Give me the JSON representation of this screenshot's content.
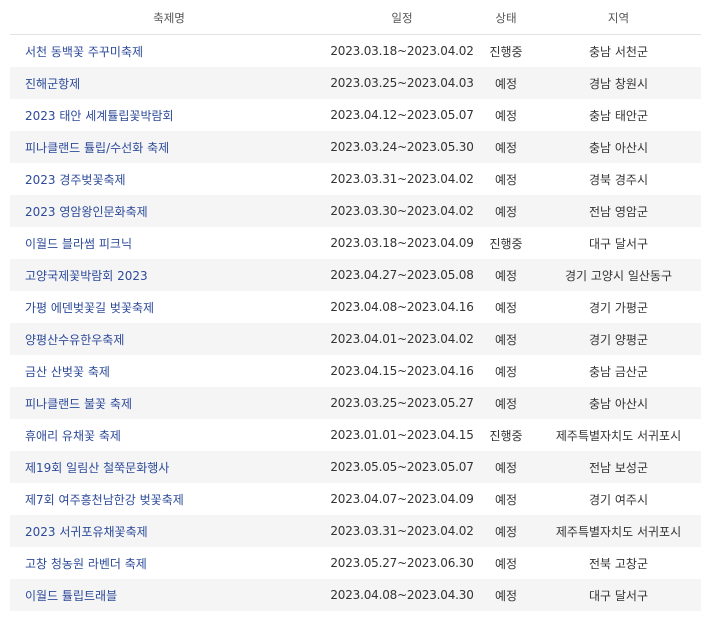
{
  "table": {
    "headers": {
      "name": "축제명",
      "period": "일정",
      "status": "상태",
      "region": "지역"
    },
    "rows": [
      {
        "name": "서천 동백꽃 주꾸미축제",
        "period": "2023.03.18~2023.04.02",
        "status": "진행중",
        "region": "충남 서천군"
      },
      {
        "name": "진해군항제",
        "period": "2023.03.25~2023.04.03",
        "status": "예정",
        "region": "경남 창원시"
      },
      {
        "name": "2023 태안 세계튤립꽃박람회",
        "period": "2023.04.12~2023.05.07",
        "status": "예정",
        "region": "충남 태안군"
      },
      {
        "name": "피나클랜드 튤립/수선화 축제",
        "period": "2023.03.24~2023.05.30",
        "status": "예정",
        "region": "충남 아산시"
      },
      {
        "name": "2023 경주벚꽃축제",
        "period": "2023.03.31~2023.04.02",
        "status": "예정",
        "region": "경북 경주시"
      },
      {
        "name": "2023 영암왕인문화축제",
        "period": "2023.03.30~2023.04.02",
        "status": "예정",
        "region": "전남 영암군"
      },
      {
        "name": "이월드 블라썸 피크닉",
        "period": "2023.03.18~2023.04.09",
        "status": "진행중",
        "region": "대구 달서구"
      },
      {
        "name": "고양국제꽃박람회 2023",
        "period": "2023.04.27~2023.05.08",
        "status": "예정",
        "region": "경기 고양시 일산동구"
      },
      {
        "name": "가평 에덴벚꽃길 벚꽃축제",
        "period": "2023.04.08~2023.04.16",
        "status": "예정",
        "region": "경기 가평군"
      },
      {
        "name": "양평산수유한우축제",
        "period": "2023.04.01~2023.04.02",
        "status": "예정",
        "region": "경기 양평군"
      },
      {
        "name": "금산 산벚꽃 축제",
        "period": "2023.04.15~2023.04.16",
        "status": "예정",
        "region": "충남 금산군"
      },
      {
        "name": "피나클랜드 불꽃 축제",
        "period": "2023.03.25~2023.05.27",
        "status": "예정",
        "region": "충남 아산시"
      },
      {
        "name": "휴애리 유채꽃 축제",
        "period": "2023.01.01~2023.04.15",
        "status": "진행중",
        "region": "제주특별자치도 서귀포시"
      },
      {
        "name": "제19회 일림산 철쭉문화행사",
        "period": "2023.05.05~2023.05.07",
        "status": "예정",
        "region": "전남 보성군"
      },
      {
        "name": "제7회 여주흥천남한강 벚꽃축제",
        "period": "2023.04.07~2023.04.09",
        "status": "예정",
        "region": "경기 여주시"
      },
      {
        "name": "2023 서귀포유채꽃축제",
        "period": "2023.03.31~2023.04.02",
        "status": "예정",
        "region": "제주특별자치도 서귀포시"
      },
      {
        "name": "고창 청농원 라벤더 축제",
        "period": "2023.05.27~2023.06.30",
        "status": "예정",
        "region": "전북 고창군"
      },
      {
        "name": "이월드 튤립트래블",
        "period": "2023.04.08~2023.04.30",
        "status": "예정",
        "region": "대구 달서구"
      }
    ]
  },
  "colors": {
    "link": "#2d4b9a",
    "row_stripe": "#f5f5f5",
    "header_text": "#555555"
  }
}
